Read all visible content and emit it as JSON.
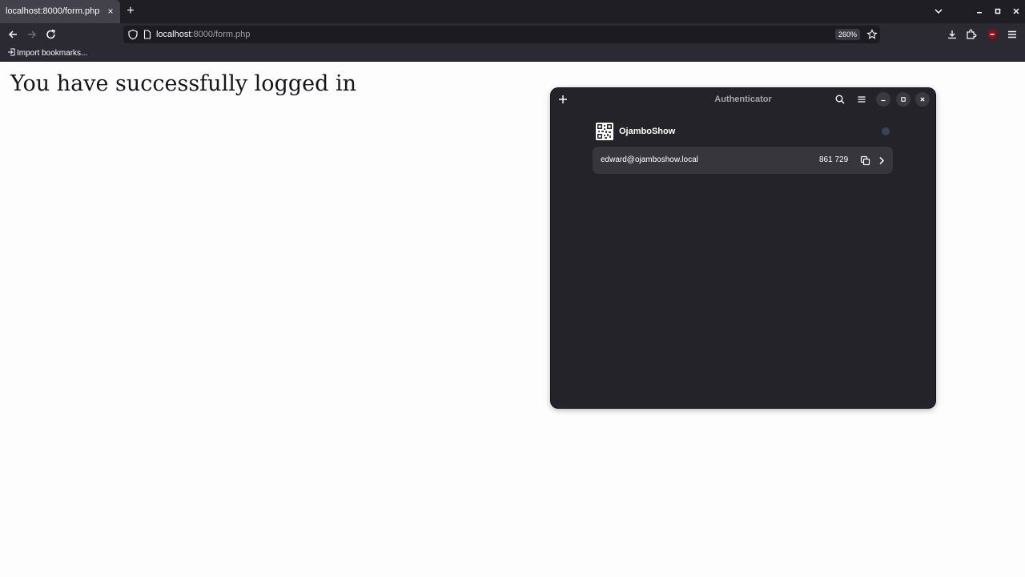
{
  "browser": {
    "tab_title": "localhost:8000/form.php",
    "tab_close": "×",
    "new_tab": "+",
    "url_host": "localhost",
    "url_rest": ":8000/form.php",
    "zoom": "260%",
    "bookmarks_import": "Import bookmarks..."
  },
  "page": {
    "headline": "You have successfully logged in"
  },
  "authenticator": {
    "title": "Authenticator",
    "provider": {
      "name": "OjamboShow",
      "logo_icon": "qr-code-icon"
    },
    "account": {
      "email": "edward@ojamboshow.local",
      "code": "861 729"
    }
  },
  "colors": {
    "browser_tabbar": "#1f1e24",
    "browser_toolbar": "#2b2a33",
    "active_tab": "#43424a",
    "page_background": "#fdfdfe",
    "auth_window": "#242329",
    "auth_row": "#37363d"
  }
}
